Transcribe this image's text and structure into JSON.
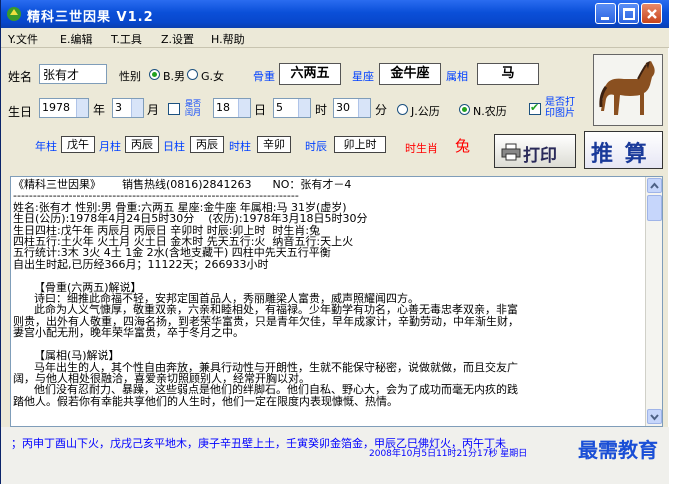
{
  "window": {
    "title": "精科三世因果   V1.2"
  },
  "menu": [
    "Y.文件",
    "E.编辑",
    "T.工具",
    "Z.设置",
    "H.帮助"
  ],
  "form": {
    "name_label": "姓名",
    "name_value": "张有才",
    "gender_label": "性别",
    "gender_male": "B.男",
    "gender_female": "G.女",
    "bone_label": "骨重",
    "bone_value": "六两五",
    "constellation_label": "星座",
    "constellation_value": "金牛座",
    "zodiac_label": "属相",
    "zodiac_value": "马",
    "birthday_label": "生日",
    "year_value": "1978",
    "year_unit": "年",
    "month_value": "3",
    "month_unit": "月",
    "leap_label_1": "是否",
    "leap_label_2": "闰月",
    "day_value": "18",
    "day_unit": "日",
    "hour_value": "5",
    "hour_unit": "时",
    "minute_value": "30",
    "minute_unit": "分",
    "solar_label": "J.公历",
    "lunar_label": "N.农历",
    "print_image_1": "是否打",
    "print_image_2": "印图片"
  },
  "pillars": {
    "year_label": "年柱",
    "year_value": "戊午",
    "month_label": "月柱",
    "month_value": "丙辰",
    "day_label": "日柱",
    "day_value": "丙辰",
    "hour_label": "时柱",
    "hour_value": "辛卯",
    "time_label": "时辰",
    "time_value": "卯上时",
    "birth_animal_label": "时生肖",
    "birth_animal_value": "兔"
  },
  "buttons": {
    "print": "打印",
    "calculate": "推 算"
  },
  "report": {
    "text": "《精科三世因果》      销售热线(0816)2841263      NO：张有才－4\n------------------------------------------------------------------------\n姓名:张有才 性别:男 骨重:六两五 星座:金牛座 年属相:马 31岁(虚岁)\n生日(公历):1978年4月24日5时30分    (农历):1978年3月18日5时30分\n生日四柱:戊午年 丙辰月 丙辰日 辛卯时 时辰:卯上时  时生肖:兔\n四柱五行:土火年 火土月 火土日 金木时 先天五行:火  纳音五行:天上火\n五行统计:3木 3火 4土 1金 2水(含地支藏干) 四柱中先天五行平衡\n自出生时起,已历经366月；11122天；266933小时\n\n      【骨重(六两五)解说】\n      诗曰：细推此命福不轻，安邦定国首品人，秀丽雕梁人富贵，威声照耀闻四方。\n      此命为人义气慷厚，敬重双亲，六亲和睦相处，有福禄。少年勤学有功名，心善无毒忠孝双亲，非富\n则贵，出外有人敬重，四海名扬，到老荣华富贵，只是青年欠佳，早年成家计，辛勤劳动，中年渐生财，\n妻宫小配无刑，晚年荣华富贵，卒于冬月之中。\n\n      【属相(马)解说】\n      马年出生的人，其个性自由奔放，兼具行动性与开朗性，生就不能保守秘密，说做就做，而且交友广\n阔，与他人相处很融洽，喜爱亲切照顾别人，经常开胸以对。\n      他们没有忍耐力、暴躁，这些弱点是他们的绊脚石。他们自私、野心大，会为了成功而毫无内疚的践\n踏他人。假若你有幸能共享他们的人生时，他们一定在限度内表现慷慨、热情。"
  },
  "status": {
    "scroll_text": "；丙申丁酉山下火，戊戌己亥平地木，庚子辛丑壁上土，壬寅癸卯金箔金，甲辰乙巳佛灯火，丙午丁未",
    "datetime": "2008年10月5日11时21分17秒      星期日"
  },
  "watermark": "最需教育",
  "colors": {
    "titlebar": "#0a4fd8",
    "accent_blue": "#0040ff",
    "accent_red": "#ff0000"
  }
}
